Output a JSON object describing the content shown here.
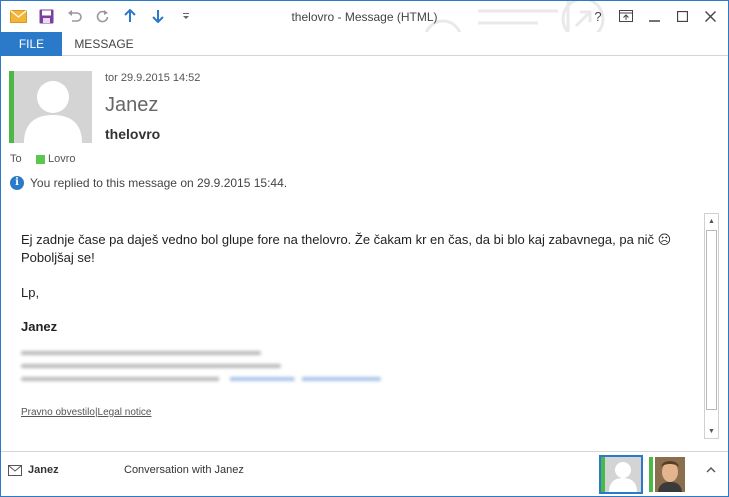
{
  "window": {
    "title": "thelovro - Message (HTML)",
    "controls": [
      "?",
      "restore-ribbon",
      "minimize",
      "maximize",
      "close"
    ]
  },
  "ribbon": {
    "tabs": [
      {
        "label": "FILE",
        "active": true
      },
      {
        "label": "MESSAGE",
        "active": false
      }
    ]
  },
  "header": {
    "date": "tor 29.9.2015 14:52",
    "sender": "Janez",
    "subject": "thelovro",
    "to_label": "To",
    "to_name": "Lovro",
    "info": "You replied to this message on 29.9.2015 15:44."
  },
  "body": {
    "line1": "Ej zadnje čase pa daješ vedno bol glupe fore na thelovro. Že čakam kr en čas, da bi blo kaj zabavnega, pa nič ☹",
    "line2": "Poboljšaj se!",
    "line3": "Lp,",
    "signature_name": "Janez",
    "legal_left": "Pravno obvestilo",
    "legal_separator": "|",
    "legal_right": "Legal notice"
  },
  "people_pane": {
    "name": "Janez",
    "conversation": "Conversation with Janez"
  },
  "colors": {
    "accent": "#2b79c9",
    "presence": "#4cb848",
    "signature": "#1e9bd7"
  }
}
